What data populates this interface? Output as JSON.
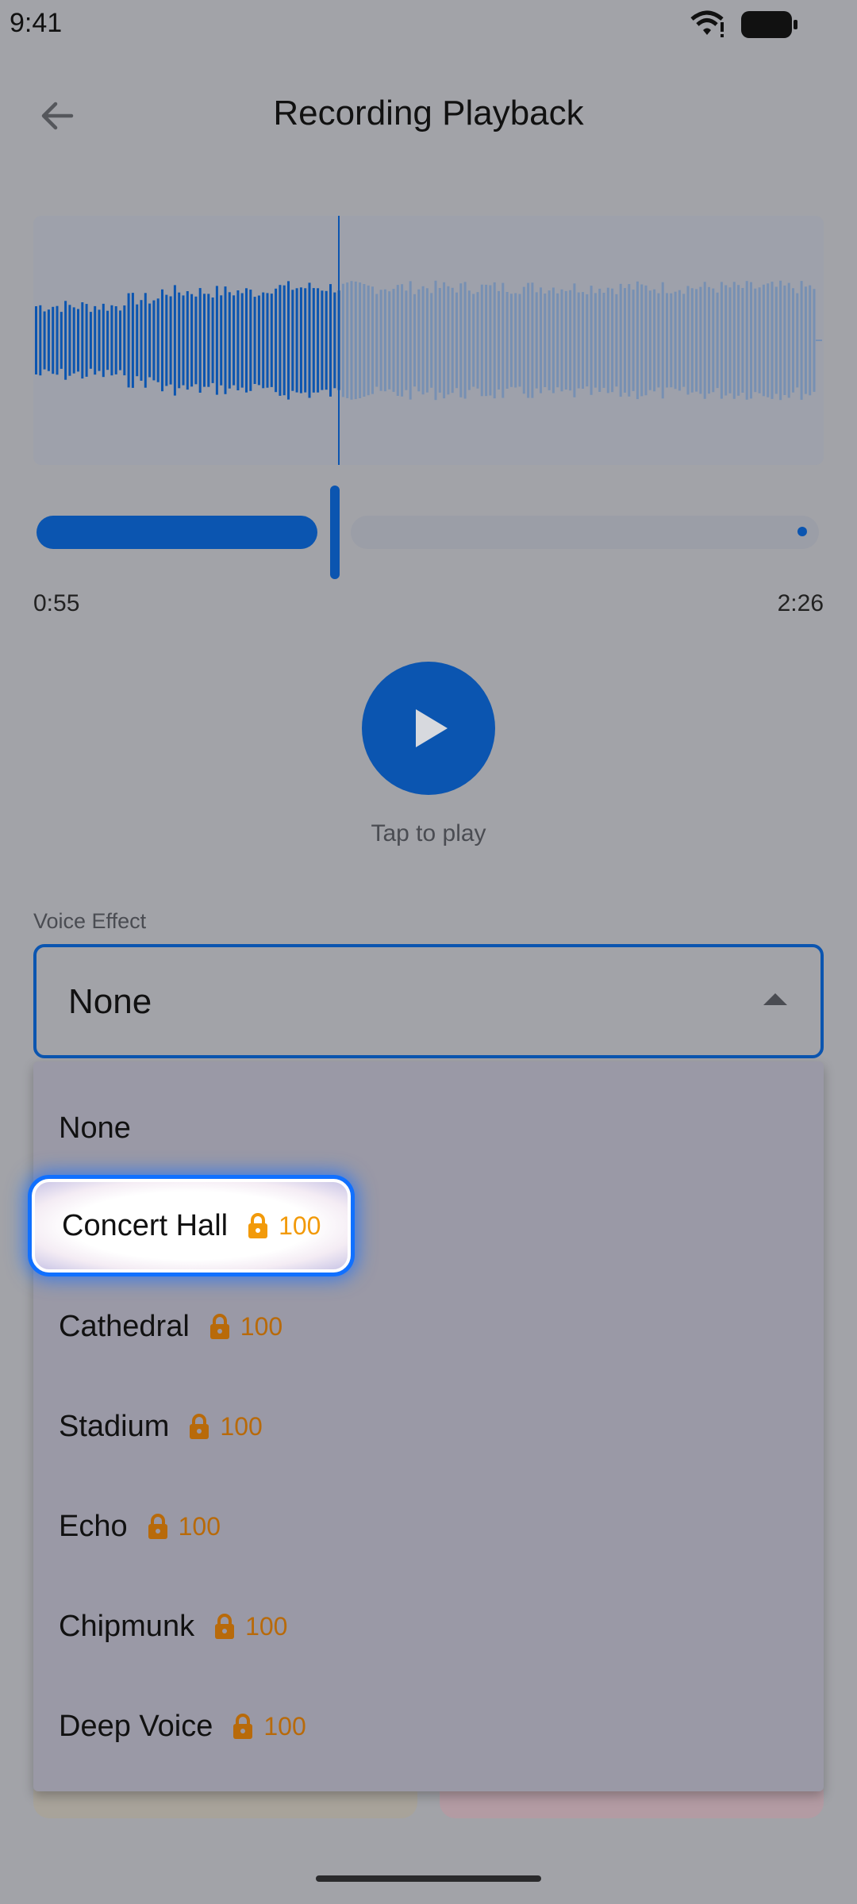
{
  "status_bar": {
    "time": "9:41"
  },
  "header": {
    "title": "Recording Playback"
  },
  "player": {
    "current_time": "0:55",
    "total_time": "2:26",
    "progress_fraction": 0.376,
    "hint": "Tap to play"
  },
  "voice_effect": {
    "label": "Voice Effect",
    "selected": "None",
    "options": [
      {
        "label": "None"
      },
      {
        "label": "Concert Hall",
        "cost": "100",
        "locked": true
      },
      {
        "label": "Cathedral",
        "cost": "100",
        "locked": true
      },
      {
        "label": "Stadium",
        "cost": "100",
        "locked": true
      },
      {
        "label": "Echo",
        "cost": "100",
        "locked": true
      },
      {
        "label": "Chipmunk",
        "cost": "100",
        "locked": true
      },
      {
        "label": "Deep Voice",
        "cost": "100",
        "locked": true
      }
    ]
  },
  "colors": {
    "accent": "#0b55b0",
    "lock": "#e89a10",
    "cost": "#b86a0a",
    "focus_ring": "#1070ff"
  },
  "icons": {
    "back": "arrow-left-icon",
    "play": "play-icon",
    "caret": "caret-up-icon",
    "lock": "lock-icon"
  }
}
